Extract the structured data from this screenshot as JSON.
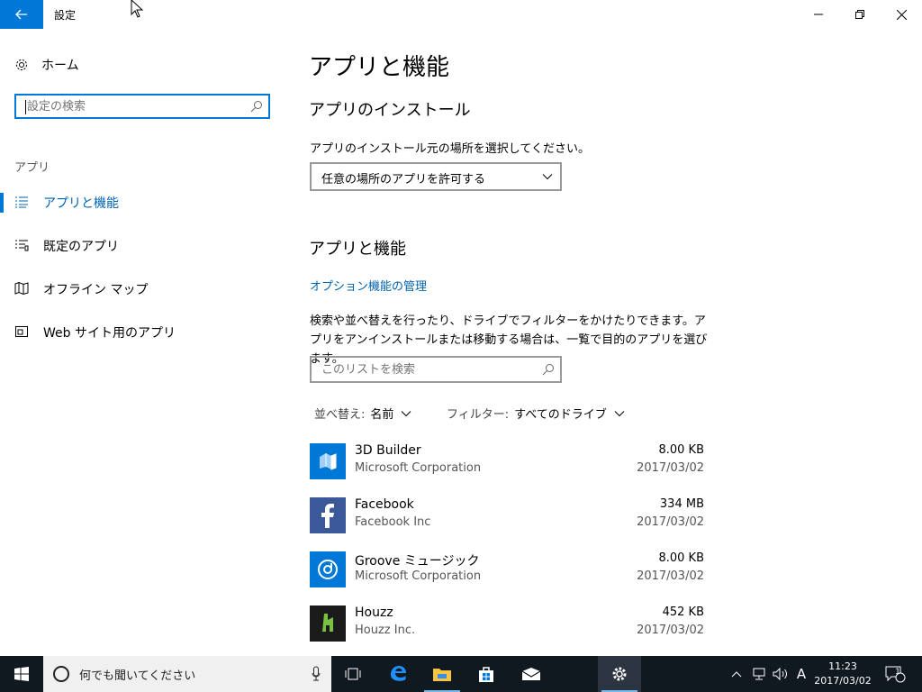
{
  "window": {
    "title": "設定"
  },
  "sidebar": {
    "home_label": "ホーム",
    "search_placeholder": "設定の検索",
    "category": "アプリ",
    "items": [
      {
        "label": "アプリと機能",
        "icon": "list-icon",
        "active": true
      },
      {
        "label": "既定のアプリ",
        "icon": "default-apps-icon",
        "active": false
      },
      {
        "label": "オフライン マップ",
        "icon": "map-icon",
        "active": false
      },
      {
        "label": "Web サイト用のアプリ",
        "icon": "website-apps-icon",
        "active": false
      }
    ]
  },
  "main": {
    "title": "アプリと機能",
    "install_section": {
      "heading": "アプリのインストール",
      "description": "アプリのインストール元の場所を選択してください。",
      "dropdown_value": "任意の場所のアプリを許可する"
    },
    "features_section": {
      "heading": "アプリと機能",
      "link": "オプション機能の管理",
      "description": "検索や並べ替えを行ったり、ドライブでフィルターをかけたりできます。アプリをアンインストールまたは移動する場合は、一覧で目的のアプリを選びます。",
      "search_placeholder": "このリストを検索",
      "sort_label": "並べ替え:",
      "sort_value": "名前",
      "filter_label": "フィルター:",
      "filter_value": "すべてのドライブ"
    },
    "apps": [
      {
        "name": "3D Builder",
        "publisher": "Microsoft Corporation",
        "size": "8.00 KB",
        "date": "2017/03/02",
        "color": "#0078d7"
      },
      {
        "name": "Facebook",
        "publisher": "Facebook Inc",
        "size": "334 MB",
        "date": "2017/03/02",
        "color": "#3b5998"
      },
      {
        "name": "Groove ミュージック",
        "publisher": "Microsoft Corporation",
        "size": "8.00 KB",
        "date": "2017/03/02",
        "color": "#0078d7"
      },
      {
        "name": "Houzz",
        "publisher": "Houzz Inc.",
        "size": "452 KB",
        "date": "2017/03/02",
        "color": "#1b1b1b"
      }
    ]
  },
  "taskbar": {
    "cortana_placeholder": "何でも聞いてください",
    "ime_indicator": "A",
    "time": "11:23",
    "date": "2017/03/02",
    "notification_count": "1"
  },
  "colors": {
    "accent": "#0078d7",
    "taskbar": "#101820"
  }
}
